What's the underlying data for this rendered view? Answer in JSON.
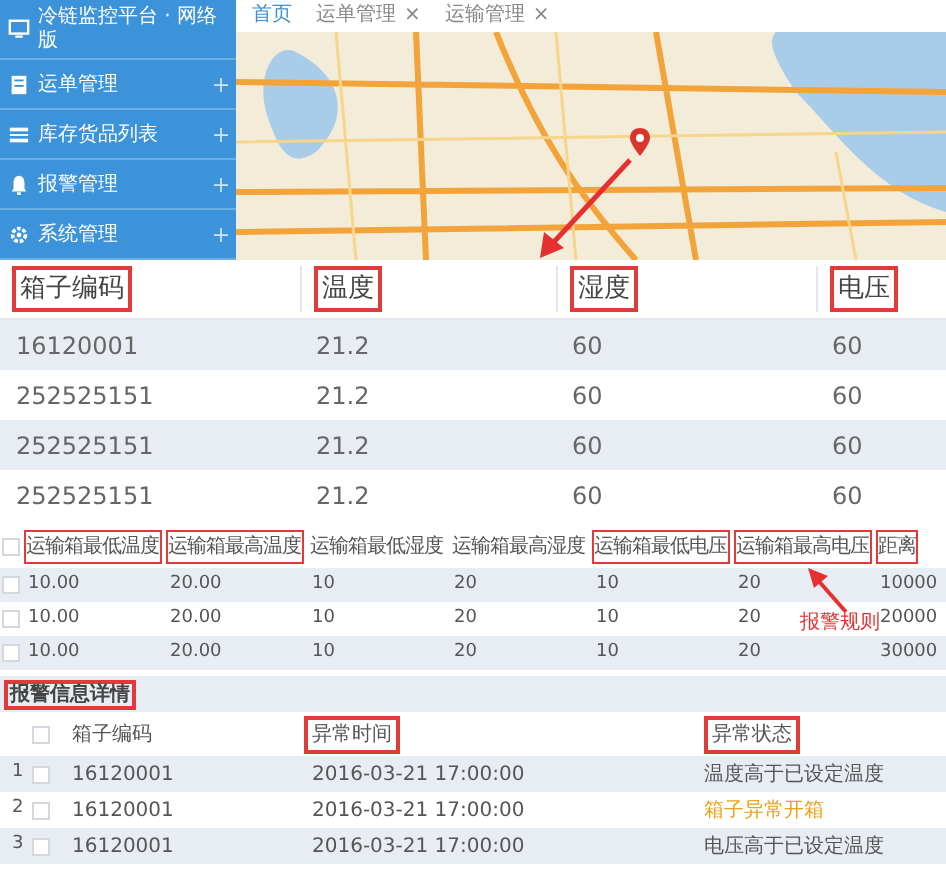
{
  "sidebar": {
    "title": "冷链监控平台 · 网络版",
    "items": [
      {
        "label": "运单管理",
        "kind": "doc"
      },
      {
        "label": "库存货品列表",
        "kind": "list"
      },
      {
        "label": "报警管理",
        "kind": "bell"
      },
      {
        "label": "系统管理",
        "kind": "gear"
      }
    ]
  },
  "tabs": [
    {
      "label": "首页",
      "selected": true,
      "closable": false
    },
    {
      "label": "运单管理",
      "selected": false,
      "closable": true
    },
    {
      "label": "运输管理",
      "selected": false,
      "closable": true
    }
  ],
  "close_glyph": "×",
  "box_table": {
    "columns": [
      {
        "label": "箱子编码",
        "highlighted": true
      },
      {
        "label": "温度",
        "highlighted": true
      },
      {
        "label": "湿度",
        "highlighted": true
      },
      {
        "label": "电压",
        "highlighted": true
      }
    ],
    "rows": [
      [
        "16120001",
        "21.2",
        "60",
        "60"
      ],
      [
        "252525151",
        "21.2",
        "60",
        "60"
      ],
      [
        "252525151",
        "21.2",
        "60",
        "60"
      ],
      [
        "252525151",
        "21.2",
        "60",
        "60"
      ]
    ]
  },
  "rule_table": {
    "columns": [
      {
        "label": "运输箱最低温度",
        "highlighted": true
      },
      {
        "label": "运输箱最高温度",
        "highlighted": true
      },
      {
        "label": "运输箱最低湿度",
        "highlighted": false
      },
      {
        "label": "运输箱最高湿度",
        "highlighted": false
      },
      {
        "label": "运输箱最低电压",
        "highlighted": true
      },
      {
        "label": "运输箱最高电压",
        "highlighted": true
      },
      {
        "label": "距离",
        "highlighted": true
      }
    ],
    "header_checked": false,
    "rows": [
      {
        "checked": false,
        "cells": [
          "10.00",
          "20.00",
          "10",
          "20",
          "10",
          "20",
          "10000"
        ]
      },
      {
        "checked": false,
        "cells": [
          "10.00",
          "20.00",
          "10",
          "20",
          "10",
          "20",
          "20000"
        ]
      },
      {
        "checked": false,
        "cells": [
          "10.00",
          "20.00",
          "10",
          "20",
          "10",
          "20",
          "30000"
        ]
      }
    ],
    "annotation": "报警规则"
  },
  "alarm_details": {
    "title": "报警信息详情",
    "header_checked": false,
    "columns": [
      {
        "label": "箱子编码",
        "highlighted": false
      },
      {
        "label": "异常时间",
        "highlighted": true
      },
      {
        "label": "异常状态",
        "highlighted": true
      }
    ],
    "rows": [
      {
        "index": "1",
        "checked": false,
        "code": "16120001",
        "time": "2016-03-21 17:00:00",
        "status": "温度高于已设定温度",
        "warning": false
      },
      {
        "index": "2",
        "checked": false,
        "code": "16120001",
        "time": "2016-03-21 17:00:00",
        "status": "箱子异常开箱",
        "warning": true
      },
      {
        "index": "3",
        "checked": false,
        "code": "16120001",
        "time": "2016-03-21 17:00:00",
        "status": "电压高于已设定温度",
        "warning": false
      }
    ]
  }
}
